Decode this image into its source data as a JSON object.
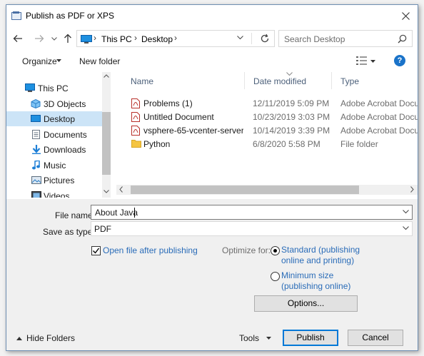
{
  "window": {
    "title": "Publish as PDF or XPS"
  },
  "address": {
    "crumbs": [
      "This PC",
      "Desktop"
    ]
  },
  "search": {
    "placeholder": "Search Desktop"
  },
  "toolbar": {
    "organize": "Organize",
    "new_folder": "New folder",
    "help": "?"
  },
  "nav": {
    "items": [
      {
        "label": "This PC",
        "icon": "pc-icon"
      },
      {
        "label": "3D Objects",
        "icon": "3d-objects-icon"
      },
      {
        "label": "Desktop",
        "icon": "desktop-icon",
        "selected": true
      },
      {
        "label": "Documents",
        "icon": "documents-icon"
      },
      {
        "label": "Downloads",
        "icon": "downloads-icon"
      },
      {
        "label": "Music",
        "icon": "music-icon"
      },
      {
        "label": "Pictures",
        "icon": "pictures-icon"
      },
      {
        "label": "Videos",
        "icon": "videos-icon"
      }
    ]
  },
  "columns": {
    "name": "Name",
    "date": "Date modified",
    "type": "Type"
  },
  "files": [
    {
      "name": "Problems (1)",
      "date": "12/11/2019 5:09 PM",
      "type": "Adobe Acrobat Docu...",
      "icon": "pdf-icon"
    },
    {
      "name": "Untitled Document",
      "date": "10/23/2019 3:03 PM",
      "type": "Adobe Acrobat Docu...",
      "icon": "pdf-icon"
    },
    {
      "name": "vsphere-65-vcenter-server-...",
      "date": "10/14/2019 3:39 PM",
      "type": "Adobe Acrobat Docu...",
      "icon": "pdf-icon"
    },
    {
      "name": "Python",
      "date": "6/8/2020 5:58 PM",
      "type": "File folder",
      "icon": "folder-icon"
    }
  ],
  "form": {
    "file_name_label": "File name:",
    "file_name_value": "About Java",
    "save_type_label": "Save as type:",
    "save_type_value": "PDF",
    "open_after_label": "Open file after publishing",
    "open_after_checked": true,
    "optimize_label": "Optimize for:",
    "opt_standard_line1": "Standard (publishing",
    "opt_standard_line2": "online and printing)",
    "opt_standard_selected": true,
    "opt_minimum_line1": "Minimum size",
    "opt_minimum_line2": "(publishing online)",
    "options_button": "Options..."
  },
  "footer": {
    "hide_folders": "Hide Folders",
    "tools": "Tools",
    "publish": "Publish",
    "cancel": "Cancel"
  },
  "colors": {
    "accent": "#0078d7",
    "selection": "#cce4f7",
    "link": "#2a6cb8"
  }
}
